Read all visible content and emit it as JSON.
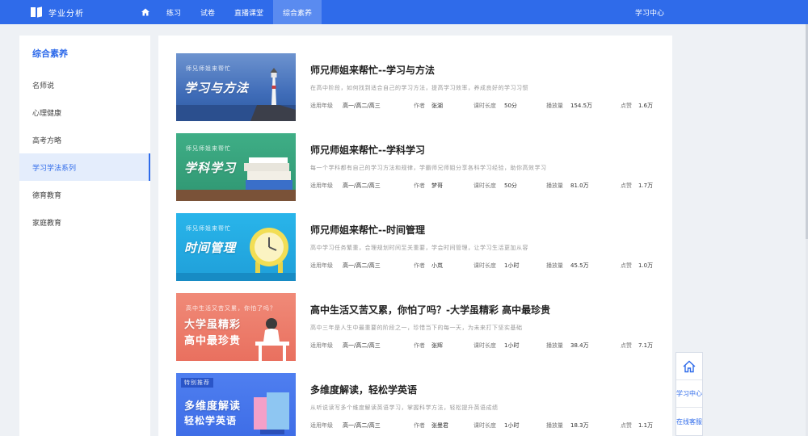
{
  "topbar": {
    "brand": "学业分析",
    "nav": [
      "练习",
      "试卷",
      "直播课堂",
      "综合素养"
    ],
    "active_nav": 3,
    "right_link": "学习中心"
  },
  "sidebar": {
    "title": "综合素养",
    "items": [
      "名师说",
      "心理健康",
      "高考方略",
      "学习学法系列",
      "德育教育",
      "家庭教育"
    ],
    "active": 3
  },
  "cards": [
    {
      "title": "师兄师姐来帮忙--学习与方法",
      "desc": "在高中阶段，如何找到适合自己的学习方法，提高学习效率，养成良好的学习习惯",
      "thumb_small": "师兄师姐来帮忙",
      "thumb_big": "学习与方法",
      "grade_label": "适用年级",
      "grade": "高一/高二/高三",
      "author_label": "作者",
      "author": "张湖",
      "duration_label": "课时长度",
      "duration": "50分",
      "views_label": "播放量",
      "views": "154.5万",
      "likes_label": "点赞",
      "likes": "1.6万"
    },
    {
      "title": "师兄师姐来帮忙--学科学习",
      "desc": "每一个学科都有自己的学习方法和规律，学霸师兄师姐分享各科学习经验，助你高效学习",
      "thumb_small": "师兄师姐来帮忙",
      "thumb_big": "学科学习",
      "grade_label": "适用年级",
      "grade": "高一/高二/高三",
      "author_label": "作者",
      "author": "梦哥",
      "duration_label": "课时长度",
      "duration": "50分",
      "views_label": "播放量",
      "views": "81.0万",
      "likes_label": "点赞",
      "likes": "1.7万"
    },
    {
      "title": "师兄师姐来帮忙--时间管理",
      "desc": "高中学习任务繁重，合理规划时间至关重要，学会时间管理，让学习生活更加从容",
      "thumb_small": "师兄师姐来帮忙",
      "thumb_big": "时间管理",
      "grade_label": "适用年级",
      "grade": "高一/高二/高三",
      "author_label": "作者",
      "author": "小岚",
      "duration_label": "课时长度",
      "duration": "1小时",
      "views_label": "播放量",
      "views": "45.5万",
      "likes_label": "点赞",
      "likes": "1.0万"
    },
    {
      "title": "高中生活又苦又累，你怕了吗？-大学虽精彩 高中最珍贵",
      "desc": "高中三年是人生中最重要的阶段之一，珍惜当下的每一天，为未来打下坚实基础",
      "thumb_small": "高中生活又苦又累，你怕了吗？",
      "thumb_big": "大学虽精彩",
      "thumb_big2": "高中最珍贵",
      "grade_label": "适用年级",
      "grade": "高一/高二/高三",
      "author_label": "作者",
      "author": "张辉",
      "duration_label": "课时长度",
      "duration": "1小时",
      "views_label": "播放量",
      "views": "38.4万",
      "likes_label": "点赞",
      "likes": "7.1万"
    },
    {
      "title": "多维度解读，轻松学英语",
      "desc": "从听说读写多个维度解读英语学习，掌握科学方法，轻松提升英语成绩",
      "thumb_small": "特别推荐",
      "thumb_big": "多维度解读",
      "thumb_big2": "轻松学英语",
      "grade_label": "适用年级",
      "grade": "高一/高二/高三",
      "author_label": "作者",
      "author": "张曼君",
      "duration_label": "课时长度",
      "duration": "1小时",
      "views_label": "播放量",
      "views": "18.3万",
      "likes_label": "点赞",
      "likes": "1.1万"
    }
  ],
  "float": {
    "items": [
      "学习中心",
      "在线客服"
    ]
  },
  "colors": {
    "primary": "#2f6bea",
    "page_bg": "#eef1f5",
    "active_bg": "#e4edfc"
  }
}
